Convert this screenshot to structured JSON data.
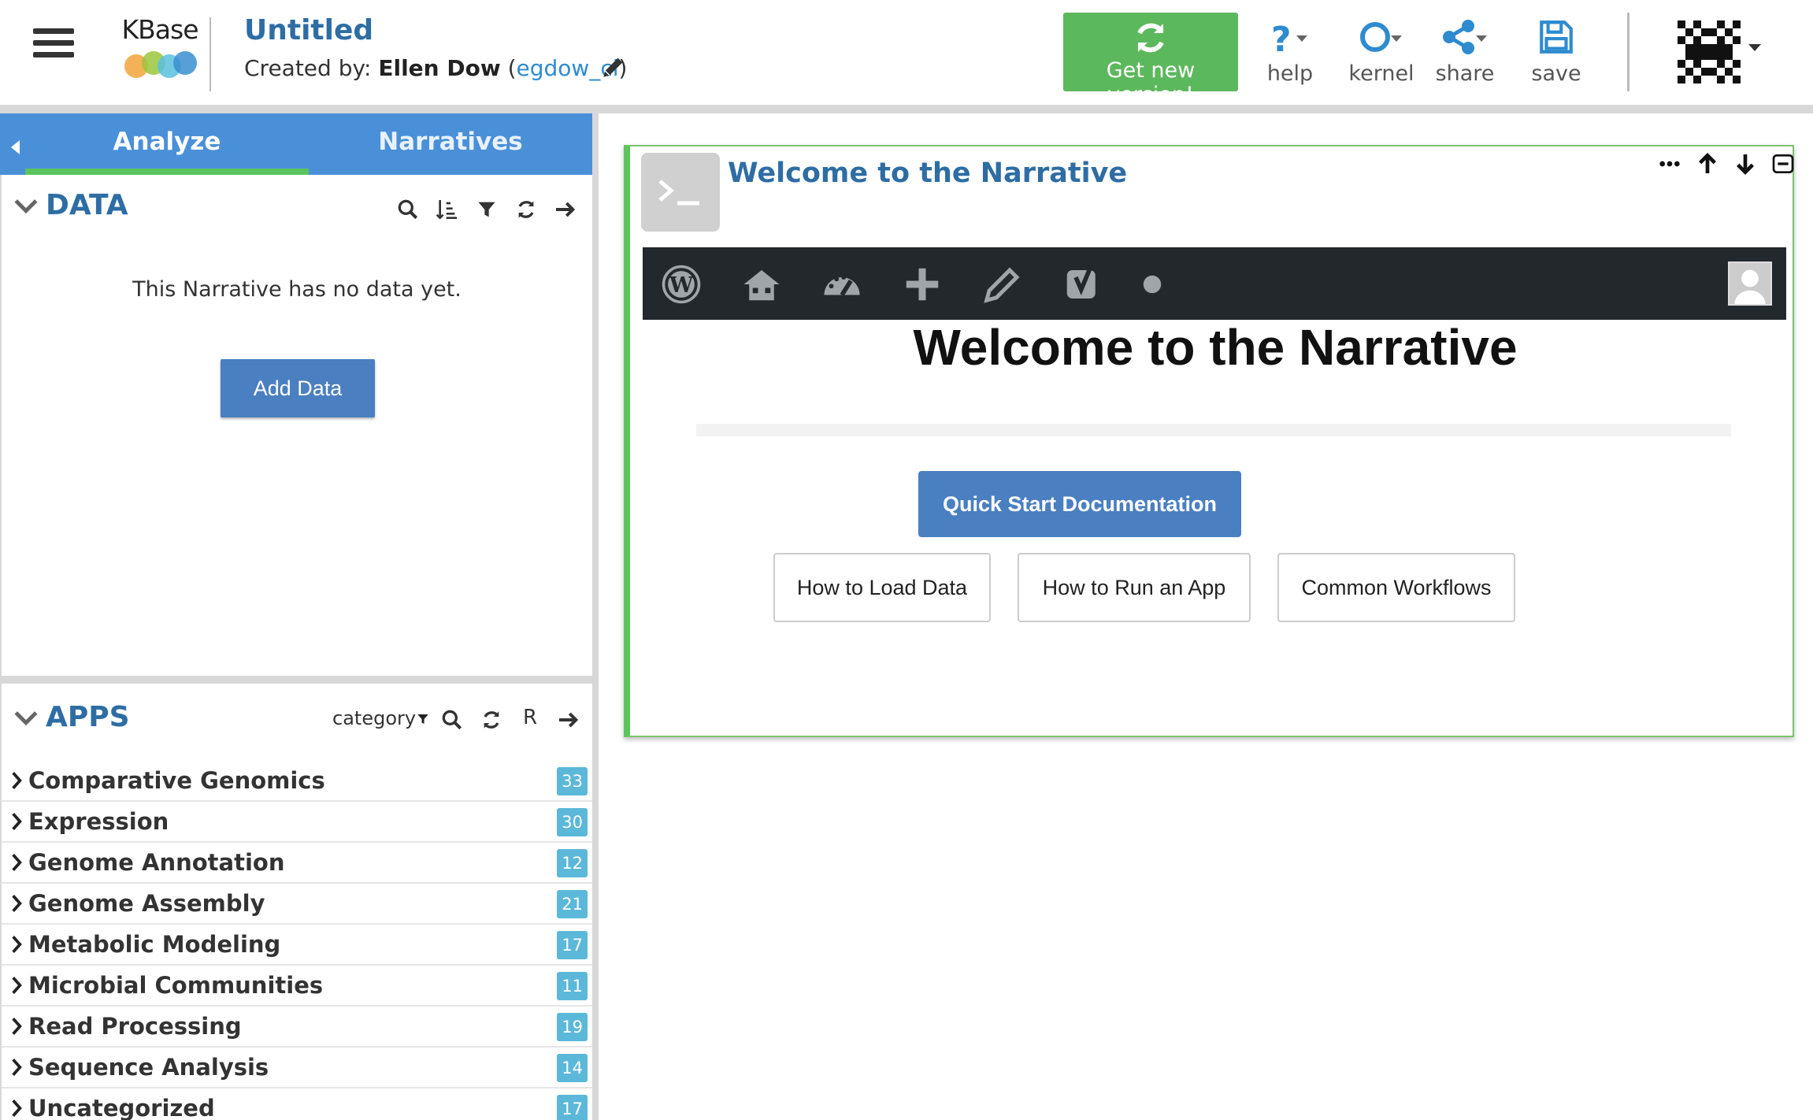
{
  "header": {
    "logo_text": "KBase",
    "narrative_title": "Untitled",
    "created_by_prefix": "Created by: ",
    "creator_name": "Ellen Dow",
    "creator_username": "egdow_ci",
    "get_new_version_label": "Get new version!",
    "help_label": "help",
    "kernel_label": "kernel",
    "share_label": "share",
    "save_label": "save"
  },
  "side_panel": {
    "tabs": [
      {
        "label": "Analyze",
        "active": true
      },
      {
        "label": "Narratives",
        "active": false
      }
    ],
    "data": {
      "title": "DATA",
      "empty_message": "This Narrative has no data yet.",
      "add_button": "Add Data"
    },
    "apps": {
      "title": "APPS",
      "category_label": "category",
      "r_label": "R",
      "categories": [
        {
          "name": "Comparative Genomics",
          "count": "33"
        },
        {
          "name": "Expression",
          "count": "30"
        },
        {
          "name": "Genome Annotation",
          "count": "12"
        },
        {
          "name": "Genome Assembly",
          "count": "21"
        },
        {
          "name": "Metabolic Modeling",
          "count": "17"
        },
        {
          "name": "Microbial Communities",
          "count": "11"
        },
        {
          "name": "Read Processing",
          "count": "19"
        },
        {
          "name": "Sequence Analysis",
          "count": "14"
        },
        {
          "name": "Uncategorized",
          "count": "17"
        }
      ]
    }
  },
  "cell": {
    "title": "Welcome to the Narrative",
    "heading": "Welcome to the Narrative",
    "quick_start_button": "Quick Start Documentation",
    "link_buttons": [
      "How to Load Data",
      "How to Run an App",
      "Common Workflows"
    ]
  },
  "colors": {
    "accent_blue": "#4a90d9",
    "title_blue": "#2e6da4",
    "green": "#5cb85c",
    "badge": "#5bb8d9",
    "wp_bar": "#23282d"
  }
}
